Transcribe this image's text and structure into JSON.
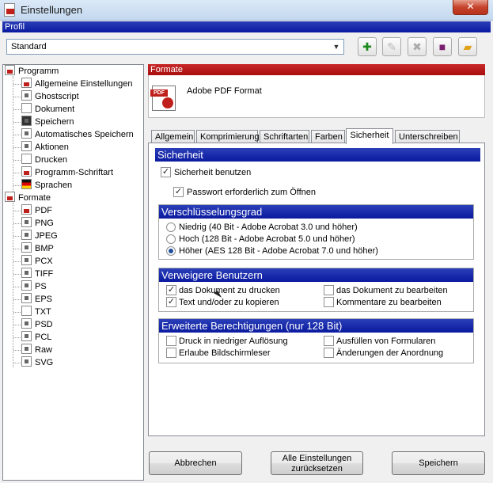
{
  "window": {
    "title": "Einstellungen",
    "close_label": "✕"
  },
  "profile": {
    "header": "Profil",
    "selected": "Standard",
    "toolbar": [
      "add-profile-icon",
      "rename-profile-icon",
      "delete-profile-icon",
      "save-profile-icon",
      "open-folder-icon"
    ]
  },
  "tree": {
    "programm": {
      "label": "Programm",
      "items": [
        "Allgemeine Einstellungen",
        "Ghostscript",
        "Dokument",
        "Speichern",
        "Automatisches Speichern",
        "Aktionen",
        "Drucken",
        "Programm-Schriftart",
        "Sprachen"
      ]
    },
    "formate": {
      "label": "Formate",
      "items": [
        "PDF",
        "PNG",
        "JPEG",
        "BMP",
        "PCX",
        "TIFF",
        "PS",
        "EPS",
        "TXT",
        "PSD",
        "PCL",
        "Raw",
        "SVG"
      ]
    }
  },
  "formats": {
    "header": "Formate",
    "name": "Adobe PDF Format",
    "icon_label": "PDF"
  },
  "tabs": [
    "Allgemein",
    "Komprimierung",
    "Schriftarten",
    "Farben",
    "Sicherheit",
    "Unterschreiben"
  ],
  "active_tab": "Sicherheit",
  "security": {
    "header": "Sicherheit",
    "use_security": {
      "label": "Sicherheit benutzen",
      "checked": true
    },
    "password_required": {
      "label": "Passwort erforderlich zum Öffnen",
      "checked": true
    },
    "encryption": {
      "header": "Verschlüsselungsgrad",
      "options": [
        {
          "label": "Niedrig (40 Bit - Adobe Acrobat 3.0 und höher)",
          "selected": false
        },
        {
          "label": "Hoch (128 Bit - Adobe Acrobat 5.0 und höher)",
          "selected": false
        },
        {
          "label": "Höher (AES 128 Bit - Adobe Acrobat 7.0 und höher)",
          "selected": true
        }
      ]
    },
    "deny": {
      "header": "Verweigere Benutzern",
      "items": [
        {
          "label": "das Dokument zu drucken",
          "checked": true
        },
        {
          "label": "das Dokument zu bearbeiten",
          "checked": false
        },
        {
          "label": "Text und/oder zu kopieren",
          "checked": true
        },
        {
          "label": "Kommentare zu bearbeiten",
          "checked": false
        }
      ]
    },
    "extended": {
      "header": "Erweiterte Berechtigungen (nur 128 Bit)",
      "items": [
        {
          "label": "Druck in niedriger Auflösung",
          "checked": false
        },
        {
          "label": "Ausfüllen von Formularen",
          "checked": false
        },
        {
          "label": "Erlaube Bildschirmleser",
          "checked": false
        },
        {
          "label": "Änderungen der Anordnung",
          "checked": false
        }
      ]
    }
  },
  "buttons": {
    "cancel": "Abbrechen",
    "reset_line1": "Alle Einstellungen",
    "reset_line2": "zurücksetzen",
    "save": "Speichern"
  }
}
